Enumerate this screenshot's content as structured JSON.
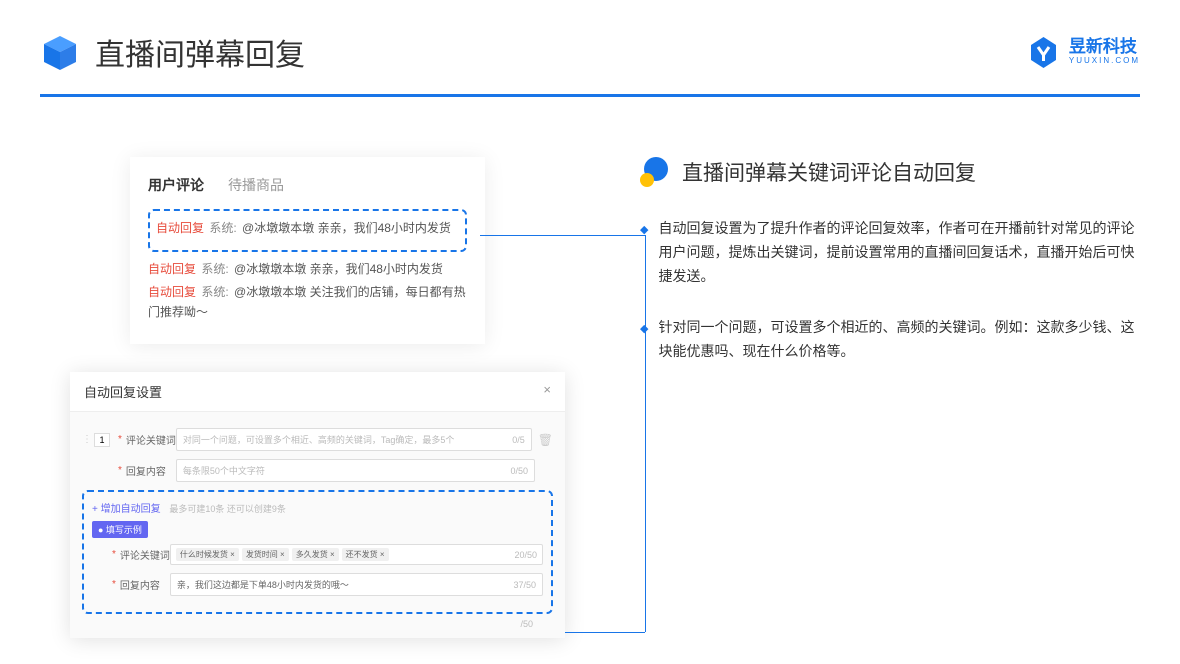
{
  "header": {
    "title": "直播间弹幕回复",
    "brand_cn": "昱新科技",
    "brand_en": "YUUXIN.COM"
  },
  "panel1": {
    "tab_active": "用户评论",
    "tab_inactive": "待播商品",
    "comments": [
      {
        "auto": "自动回复",
        "sys": "系统:",
        "text": "@冰墩墩本墩 亲亲，我们48小时内发货"
      },
      {
        "auto": "自动回复",
        "sys": "系统:",
        "text": "@冰墩墩本墩 亲亲，我们48小时内发货"
      },
      {
        "auto": "自动回复",
        "sys": "系统:",
        "text": "@冰墩墩本墩 关注我们的店铺，每日都有热门推荐呦～"
      }
    ]
  },
  "panel2": {
    "title": "自动回复设置",
    "close": "×",
    "index": "1",
    "keyword_label": "评论关键词",
    "keyword_placeholder": "对同一个问题，可设置多个相近、高频的关键词，Tag确定，最多5个",
    "keyword_counter": "0/5",
    "content_label": "回复内容",
    "content_placeholder": "每条限50个中文字符",
    "content_counter": "0/50",
    "add_link": "+ 增加自动回复",
    "add_hint": "最多可建10条 还可以创建9条",
    "example_badge": "● 填写示例",
    "ex_keyword_label": "评论关键词",
    "ex_tags": [
      "什么时候发货 ×",
      "发货时间 ×",
      "多久发货 ×",
      "还不发货 ×"
    ],
    "ex_keyword_counter": "20/50",
    "ex_content_label": "回复内容",
    "ex_content_value": "亲，我们这边都是下单48小时内发货的哦～",
    "ex_content_counter": "37/50",
    "extra_counter": "/50"
  },
  "right": {
    "section_title": "直播间弹幕关键词评论自动回复",
    "bullets": [
      "自动回复设置为了提升作者的评论回复效率，作者可在开播前针对常见的评论用户问题，提炼出关键词，提前设置常用的直播间回复话术，直播开始后可快捷发送。",
      "针对同一个问题，可设置多个相近的、高频的关键词。例如：这款多少钱、这块能优惠吗、现在什么价格等。"
    ]
  }
}
